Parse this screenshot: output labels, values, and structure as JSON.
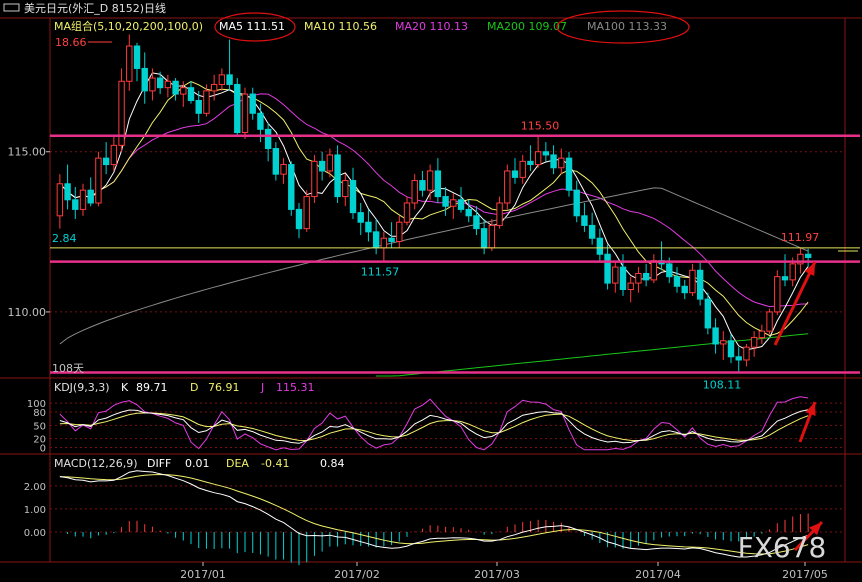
{
  "window": {
    "title": "美元日元(外汇_D 8152)日线",
    "icon": "window-icon"
  },
  "ma_legend": {
    "label": "MA组合(5,10,20,200,100,0)",
    "ma5": "MA5 111.51",
    "ma10": "MA10 110.56",
    "ma20": "MA20 110.13",
    "ma200": "MA200 109.07",
    "ma100": "MA100 113.33"
  },
  "kdj_legend": {
    "label": "KDJ(9,3,3)",
    "k_label": "K",
    "k_value": "89.71",
    "d_label": "D",
    "d_value": "76.91",
    "j_label": "J",
    "j_value": "115.31"
  },
  "macd_legend": {
    "label": "MACD(12,26,9)",
    "diff_label": "DIFF",
    "diff_value": "0.01",
    "dea_label": "DEA",
    "dea_value": "-0.41",
    "macd_value": "0.84"
  },
  "annotations": {
    "high": "18.66",
    "left_level": "2.84",
    "days": "108天",
    "peak": "115.50",
    "mid_low": "111.57",
    "low": "108.11",
    "last_high": "111.97"
  },
  "watermark": "FX678",
  "colors": {
    "bg": "#000000",
    "bull": "#00d2d2",
    "bear": "#ff3b3b",
    "ma5": "#ffffff",
    "ma10": "#f0f06a",
    "ma20": "#e23ce2",
    "ma200": "#19c619",
    "ma100": "#8a8a8a",
    "level_line": "#e8308a",
    "yellow_line": "#e6e65a",
    "grid": "#7a1010",
    "axis_text": "#c0c0c0",
    "arrow": "#e01010"
  },
  "chart_data": [
    {
      "type": "candlestick",
      "title": "美元日元(外汇_D 8152)日线",
      "x_ticks": [
        "2017/01",
        "2017/02",
        "2017/03",
        "2017/04",
        "2017/05"
      ],
      "y_ticks": [
        110.0,
        115.0
      ],
      "y_tick_labels": [
        "110.00",
        "115.00"
      ],
      "ylim": [
        108.0,
        118.8
      ],
      "horizontal_levels": [
        115.5,
        111.57,
        108.11
      ],
      "yellow_level": 112.0,
      "candles": [
        {
          "o": 113.0,
          "h": 114.3,
          "l": 112.6,
          "c": 114.0
        },
        {
          "o": 114.0,
          "h": 114.6,
          "l": 113.2,
          "c": 113.5
        },
        {
          "o": 113.5,
          "h": 113.9,
          "l": 112.9,
          "c": 113.2
        },
        {
          "o": 113.2,
          "h": 114.0,
          "l": 113.0,
          "c": 113.8
        },
        {
          "o": 113.8,
          "h": 114.2,
          "l": 113.3,
          "c": 113.4
        },
        {
          "o": 113.4,
          "h": 115.0,
          "l": 113.3,
          "c": 114.8
        },
        {
          "o": 114.8,
          "h": 115.3,
          "l": 114.3,
          "c": 114.6
        },
        {
          "o": 114.6,
          "h": 115.5,
          "l": 114.4,
          "c": 115.2
        },
        {
          "o": 115.2,
          "h": 117.6,
          "l": 115.0,
          "c": 117.2
        },
        {
          "o": 117.2,
          "h": 118.66,
          "l": 116.9,
          "c": 118.3
        },
        {
          "o": 118.3,
          "h": 118.4,
          "l": 117.2,
          "c": 117.6
        },
        {
          "o": 117.6,
          "h": 118.1,
          "l": 116.5,
          "c": 116.9
        },
        {
          "o": 116.9,
          "h": 117.6,
          "l": 116.6,
          "c": 117.3
        },
        {
          "o": 117.3,
          "h": 117.5,
          "l": 116.8,
          "c": 117.0
        },
        {
          "o": 117.0,
          "h": 117.4,
          "l": 116.7,
          "c": 117.2
        },
        {
          "o": 117.2,
          "h": 117.3,
          "l": 116.6,
          "c": 116.8
        },
        {
          "o": 116.8,
          "h": 117.2,
          "l": 116.4,
          "c": 117.0
        },
        {
          "o": 117.0,
          "h": 117.2,
          "l": 116.5,
          "c": 116.6
        },
        {
          "o": 116.6,
          "h": 116.9,
          "l": 115.9,
          "c": 116.2
        },
        {
          "o": 116.2,
          "h": 117.1,
          "l": 116.1,
          "c": 116.9
        },
        {
          "o": 116.9,
          "h": 117.4,
          "l": 116.6,
          "c": 117.1
        },
        {
          "o": 117.1,
          "h": 117.6,
          "l": 116.9,
          "c": 117.4
        },
        {
          "o": 117.4,
          "h": 118.5,
          "l": 116.9,
          "c": 117.1
        },
        {
          "o": 117.1,
          "h": 117.3,
          "l": 115.5,
          "c": 115.6
        },
        {
          "o": 115.6,
          "h": 117.0,
          "l": 115.4,
          "c": 116.8
        },
        {
          "o": 116.8,
          "h": 117.0,
          "l": 116.0,
          "c": 116.2
        },
        {
          "o": 116.2,
          "h": 116.5,
          "l": 115.3,
          "c": 115.7
        },
        {
          "o": 115.7,
          "h": 115.9,
          "l": 114.7,
          "c": 115.1
        },
        {
          "o": 115.1,
          "h": 115.3,
          "l": 114.1,
          "c": 114.3
        },
        {
          "o": 114.3,
          "h": 114.8,
          "l": 114.0,
          "c": 114.6
        },
        {
          "o": 114.6,
          "h": 114.7,
          "l": 113.0,
          "c": 113.2
        },
        {
          "o": 113.2,
          "h": 113.4,
          "l": 112.3,
          "c": 112.6
        },
        {
          "o": 112.6,
          "h": 113.8,
          "l": 112.5,
          "c": 113.6
        },
        {
          "o": 113.6,
          "h": 114.9,
          "l": 113.4,
          "c": 114.7
        },
        {
          "o": 114.7,
          "h": 115.0,
          "l": 114.1,
          "c": 114.4
        },
        {
          "o": 114.4,
          "h": 115.1,
          "l": 114.2,
          "c": 114.9
        },
        {
          "o": 114.9,
          "h": 115.2,
          "l": 113.4,
          "c": 113.6
        },
        {
          "o": 113.6,
          "h": 114.3,
          "l": 113.3,
          "c": 114.1
        },
        {
          "o": 114.1,
          "h": 114.5,
          "l": 112.9,
          "c": 113.1
        },
        {
          "o": 113.1,
          "h": 113.4,
          "l": 112.4,
          "c": 112.8
        },
        {
          "o": 112.8,
          "h": 113.2,
          "l": 112.2,
          "c": 112.5
        },
        {
          "o": 112.5,
          "h": 112.9,
          "l": 111.8,
          "c": 112.0
        },
        {
          "o": 112.0,
          "h": 112.5,
          "l": 111.57,
          "c": 112.3
        },
        {
          "o": 112.3,
          "h": 112.8,
          "l": 112.0,
          "c": 112.2
        },
        {
          "o": 112.2,
          "h": 113.0,
          "l": 112.0,
          "c": 112.8
        },
        {
          "o": 112.8,
          "h": 113.6,
          "l": 112.7,
          "c": 113.4
        },
        {
          "o": 113.4,
          "h": 114.3,
          "l": 113.2,
          "c": 114.1
        },
        {
          "o": 114.1,
          "h": 114.4,
          "l": 113.6,
          "c": 113.8
        },
        {
          "o": 113.8,
          "h": 114.6,
          "l": 113.5,
          "c": 114.4
        },
        {
          "o": 114.4,
          "h": 114.8,
          "l": 113.4,
          "c": 113.6
        },
        {
          "o": 113.6,
          "h": 113.9,
          "l": 113.0,
          "c": 113.3
        },
        {
          "o": 113.3,
          "h": 113.7,
          "l": 112.9,
          "c": 113.5
        },
        {
          "o": 113.5,
          "h": 113.9,
          "l": 113.1,
          "c": 113.2
        },
        {
          "o": 113.2,
          "h": 113.5,
          "l": 112.8,
          "c": 113.0
        },
        {
          "o": 113.0,
          "h": 113.3,
          "l": 112.4,
          "c": 112.6
        },
        {
          "o": 112.6,
          "h": 112.9,
          "l": 111.8,
          "c": 112.0
        },
        {
          "o": 112.0,
          "h": 112.9,
          "l": 111.9,
          "c": 112.7
        },
        {
          "o": 112.7,
          "h": 113.6,
          "l": 112.6,
          "c": 113.4
        },
        {
          "o": 113.4,
          "h": 114.6,
          "l": 113.2,
          "c": 114.4
        },
        {
          "o": 114.4,
          "h": 114.8,
          "l": 114.0,
          "c": 114.2
        },
        {
          "o": 114.2,
          "h": 114.9,
          "l": 114.0,
          "c": 114.7
        },
        {
          "o": 114.7,
          "h": 115.2,
          "l": 114.4,
          "c": 114.6
        },
        {
          "o": 114.6,
          "h": 115.5,
          "l": 114.5,
          "c": 115.0
        },
        {
          "o": 115.0,
          "h": 115.3,
          "l": 114.7,
          "c": 114.9
        },
        {
          "o": 114.9,
          "h": 115.2,
          "l": 114.3,
          "c": 114.5
        },
        {
          "o": 114.5,
          "h": 115.1,
          "l": 114.3,
          "c": 114.8
        },
        {
          "o": 114.8,
          "h": 115.0,
          "l": 113.6,
          "c": 113.8
        },
        {
          "o": 113.8,
          "h": 114.1,
          "l": 112.8,
          "c": 113.0
        },
        {
          "o": 113.0,
          "h": 113.4,
          "l": 112.5,
          "c": 112.7
        },
        {
          "o": 112.7,
          "h": 113.1,
          "l": 112.1,
          "c": 112.3
        },
        {
          "o": 112.3,
          "h": 112.6,
          "l": 111.6,
          "c": 111.8
        },
        {
          "o": 111.8,
          "h": 112.1,
          "l": 110.7,
          "c": 110.9
        },
        {
          "o": 110.9,
          "h": 111.6,
          "l": 110.6,
          "c": 111.4
        },
        {
          "o": 111.4,
          "h": 111.8,
          "l": 110.5,
          "c": 110.7
        },
        {
          "o": 110.7,
          "h": 111.1,
          "l": 110.3,
          "c": 110.9
        },
        {
          "o": 110.9,
          "h": 111.4,
          "l": 110.6,
          "c": 111.2
        },
        {
          "o": 111.2,
          "h": 111.5,
          "l": 110.8,
          "c": 111.0
        },
        {
          "o": 111.0,
          "h": 111.8,
          "l": 110.9,
          "c": 111.6
        },
        {
          "o": 111.6,
          "h": 112.2,
          "l": 111.3,
          "c": 111.5
        },
        {
          "o": 111.5,
          "h": 111.7,
          "l": 110.9,
          "c": 111.1
        },
        {
          "o": 111.1,
          "h": 111.4,
          "l": 110.6,
          "c": 110.8
        },
        {
          "o": 110.8,
          "h": 111.0,
          "l": 110.4,
          "c": 110.6
        },
        {
          "o": 110.6,
          "h": 111.5,
          "l": 110.5,
          "c": 111.3
        },
        {
          "o": 111.3,
          "h": 111.6,
          "l": 110.2,
          "c": 110.4
        },
        {
          "o": 110.4,
          "h": 110.6,
          "l": 109.3,
          "c": 109.5
        },
        {
          "o": 109.5,
          "h": 109.8,
          "l": 108.7,
          "c": 109.0
        },
        {
          "o": 109.0,
          "h": 109.4,
          "l": 108.5,
          "c": 109.1
        },
        {
          "o": 109.1,
          "h": 109.3,
          "l": 108.4,
          "c": 108.6
        },
        {
          "o": 108.6,
          "h": 108.9,
          "l": 108.11,
          "c": 108.5
        },
        {
          "o": 108.5,
          "h": 109.0,
          "l": 108.3,
          "c": 108.9
        },
        {
          "o": 108.9,
          "h": 109.4,
          "l": 108.6,
          "c": 109.2
        },
        {
          "o": 109.2,
          "h": 109.6,
          "l": 109.0,
          "c": 109.4
        },
        {
          "o": 109.4,
          "h": 110.1,
          "l": 109.3,
          "c": 110.0
        },
        {
          "o": 110.0,
          "h": 111.3,
          "l": 109.9,
          "c": 111.1
        },
        {
          "o": 111.1,
          "h": 111.8,
          "l": 110.8,
          "c": 111.0
        },
        {
          "o": 111.0,
          "h": 111.7,
          "l": 110.8,
          "c": 111.5
        },
        {
          "o": 111.5,
          "h": 112.0,
          "l": 111.2,
          "c": 111.8
        },
        {
          "o": 111.8,
          "h": 111.97,
          "l": 111.4,
          "c": 111.7
        }
      ]
    },
    {
      "type": "line",
      "title": "KDJ(9,3,3)",
      "y_ticks": [
        0,
        20,
        50,
        80,
        100
      ],
      "y_tick_labels": [
        "0",
        "20",
        "50",
        "80",
        "100"
      ],
      "ylim": [
        -10,
        125
      ]
    },
    {
      "type": "bar",
      "title": "MACD(12,26,9)",
      "y_ticks": [
        0.0,
        1.0,
        2.0
      ],
      "y_tick_labels": [
        "0.00",
        "1.00",
        "2.00"
      ],
      "ylim": [
        -1.3,
        2.6
      ]
    }
  ]
}
